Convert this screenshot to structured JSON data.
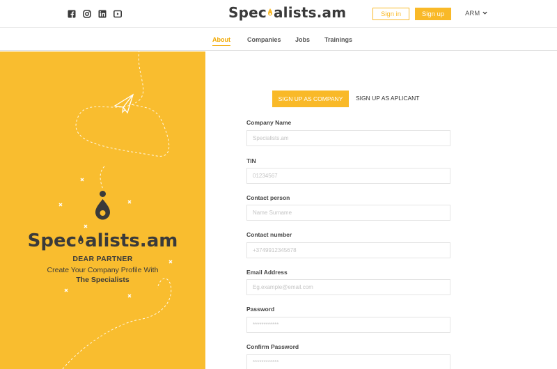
{
  "header": {
    "social_icons": [
      "facebook-icon",
      "instagram-icon",
      "linkedin-icon",
      "youtube-icon"
    ],
    "logo_prefix": "Spec",
    "logo_suffix": "alists.am",
    "signin_label": "Sign in",
    "signup_label": "Sign up",
    "language": "ARM"
  },
  "nav": {
    "items": [
      {
        "label": "About",
        "active": true
      },
      {
        "label": "Companies",
        "active": false
      },
      {
        "label": "Jobs",
        "active": false
      },
      {
        "label": "Trainings",
        "active": false
      }
    ]
  },
  "left_panel": {
    "logo_prefix": "Spec",
    "logo_suffix": "alists.am",
    "heading": "DEAR PARTNER",
    "line1": "Create Your Company Profile With",
    "line2": "The Specialists"
  },
  "form": {
    "tab_company": "SIGN UP AS COMPANY",
    "tab_applicant": "SIGN UP AS APLICANT",
    "fields": [
      {
        "label": "Company Name",
        "placeholder": "Specialists.am"
      },
      {
        "label": "TIN",
        "placeholder": "01234567"
      },
      {
        "label": "Contact person",
        "placeholder": "Name Surname"
      },
      {
        "label": "Contact number",
        "placeholder": "+3749912345678"
      },
      {
        "label": "Email Address",
        "placeholder": "Eg.example@email.com"
      },
      {
        "label": "Password",
        "placeholder": "************"
      },
      {
        "label": "Confirm Password",
        "placeholder": "************"
      }
    ]
  },
  "colors": {
    "accent": "#f9b928",
    "panel": "#f9bd2f",
    "dark": "#3a3a3a"
  }
}
